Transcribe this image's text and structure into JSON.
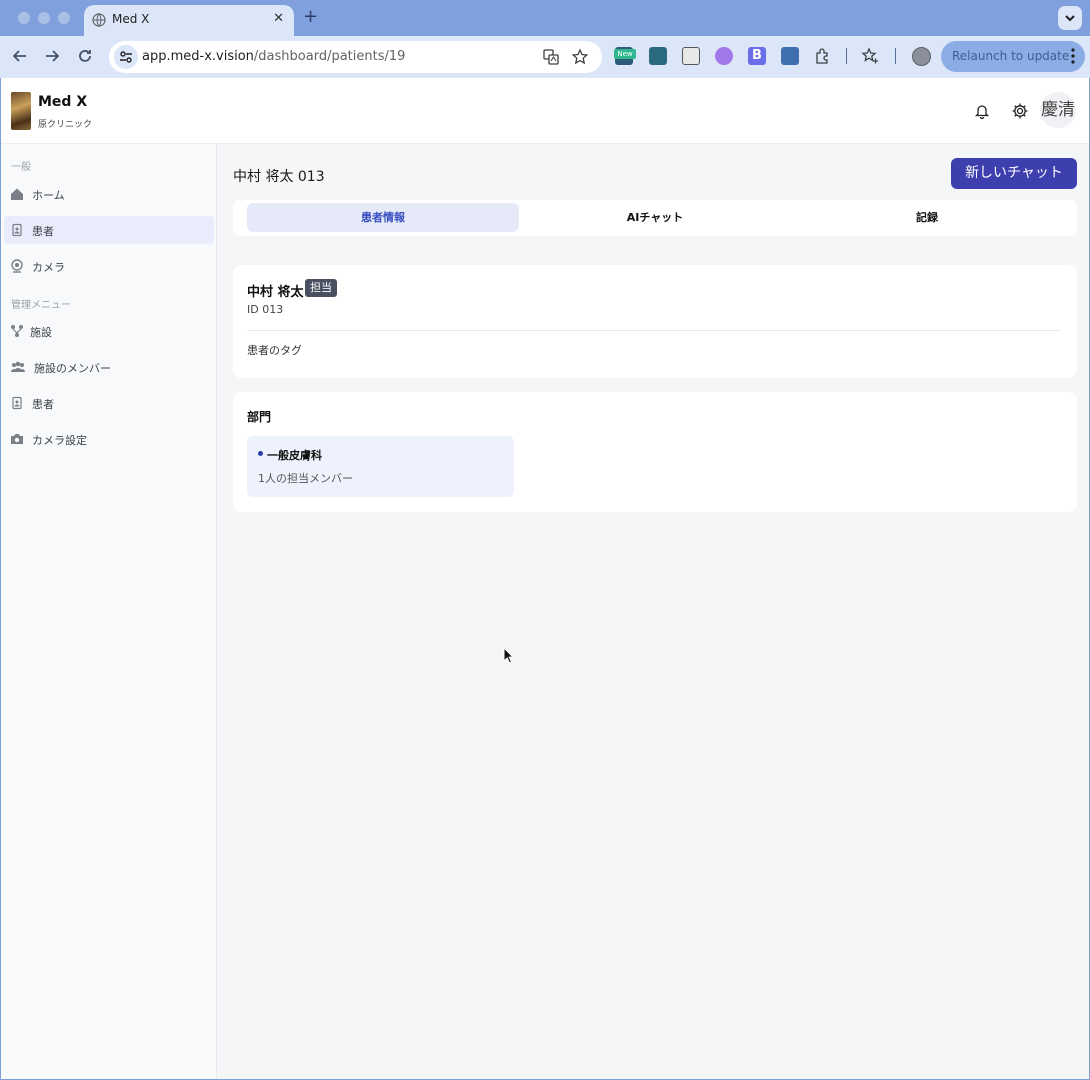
{
  "browser": {
    "tab_title": "Med X",
    "url_host": "app.med-x.vision",
    "url_path": "/dashboard/patients/19",
    "extension_badge": "New",
    "relaunch_label": "Relaunch to update"
  },
  "app": {
    "brand": "Med X",
    "clinic": "原クリニック",
    "avatar": "慶清"
  },
  "sidebar": {
    "general_label": "一般",
    "general_items": [
      {
        "label": "ホーム",
        "icon": "home-icon"
      },
      {
        "label": "患者",
        "icon": "patient-icon"
      },
      {
        "label": "カメラ",
        "icon": "camera-icon"
      }
    ],
    "admin_label": "管理メニュー",
    "admin_items": [
      {
        "label": "施設",
        "icon": "facility-icon"
      },
      {
        "label": "施設のメンバー",
        "icon": "members-icon"
      },
      {
        "label": "患者",
        "icon": "patient-icon"
      },
      {
        "label": "カメラ設定",
        "icon": "camera-settings-icon"
      }
    ]
  },
  "main": {
    "title": "中村 将太 013",
    "new_chat_label": "新しいチャット",
    "tabs": [
      {
        "label": "患者情報",
        "active": true
      },
      {
        "label": "AIチャット",
        "active": false
      },
      {
        "label": "記録",
        "active": false
      }
    ],
    "patient": {
      "name": "中村 将太",
      "badge": "担当",
      "id": "ID 013",
      "tags_label": "患者のタグ"
    },
    "departments": {
      "title": "部門",
      "items": [
        {
          "name": "一般皮膚科",
          "members": "1人の担当メンバー"
        }
      ]
    }
  },
  "colors": {
    "accent": "#3d3fae",
    "tab_active_bg": "#e6eaf8",
    "sidebar_active_bg": "#e9edfb"
  }
}
